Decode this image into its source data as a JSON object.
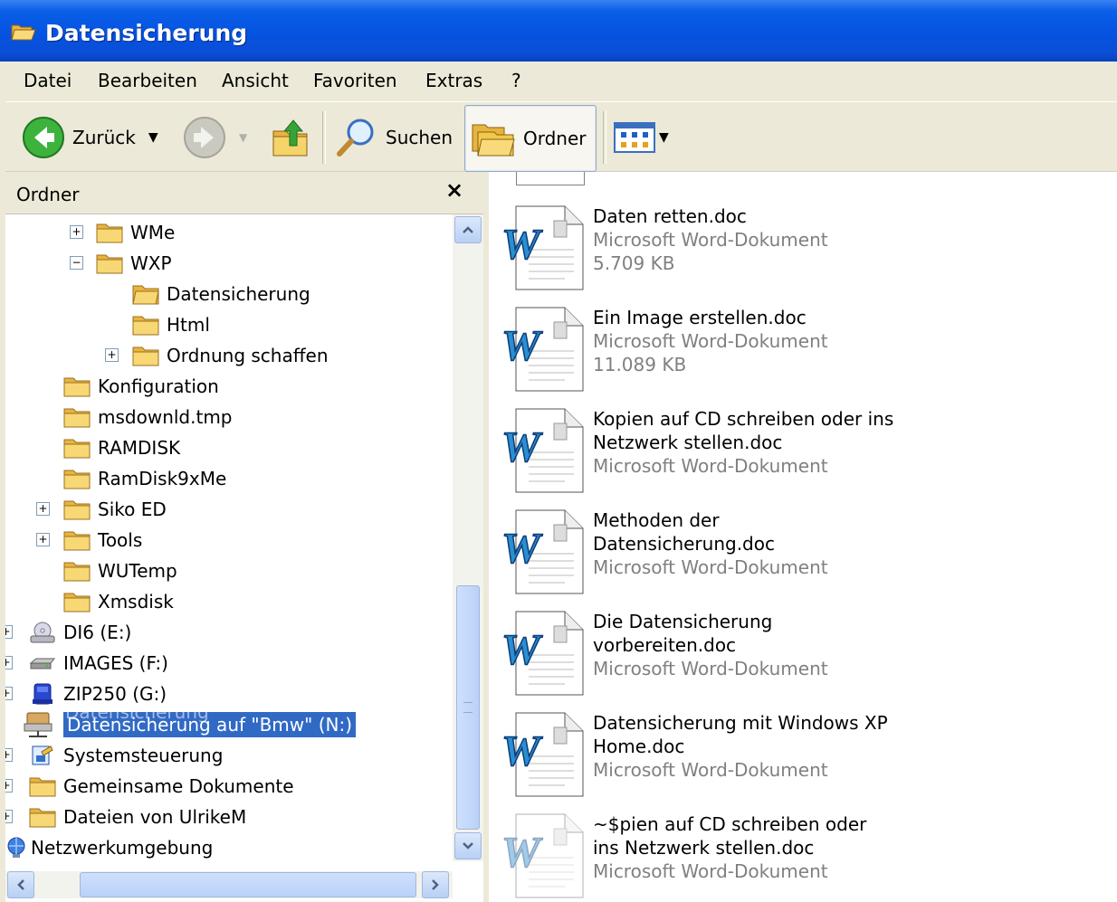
{
  "window": {
    "title": "Datensicherung"
  },
  "menu": [
    "Datei",
    "Bearbeiten",
    "Ansicht",
    "Favoriten",
    "Extras",
    "?"
  ],
  "toolbar": {
    "back": "Zurück",
    "search": "Suchen",
    "folders": "Ordner"
  },
  "folder_pane": {
    "title": "Ordner",
    "close": "×",
    "tree": [
      {
        "label": "WMe",
        "expander": "+"
      },
      {
        "label": "WXP",
        "expander": "−"
      },
      {
        "label": "Datensicherung"
      },
      {
        "label": "Html"
      },
      {
        "label": "Ordnung schaffen",
        "expander": "+"
      },
      {
        "label": "Konfiguration"
      },
      {
        "label": "msdownld.tmp"
      },
      {
        "label": "RAMDISK"
      },
      {
        "label": "RamDisk9xMe"
      },
      {
        "label": "Siko ED",
        "expander": "+"
      },
      {
        "label": "Tools",
        "expander": "+"
      },
      {
        "label": "WUTemp"
      },
      {
        "label": "Xmsdisk"
      },
      {
        "label": "DI6 (E:)",
        "expander": "+"
      },
      {
        "label": "IMAGES (F:)",
        "expander": "+"
      },
      {
        "label": "ZIP250 (G:)",
        "expander": "+"
      },
      {
        "label": "Datensicherung auf \"Bmw\" (N:)",
        "drag_ghost": "Datensicherung"
      },
      {
        "label": "Systemsteuerung",
        "expander": "+"
      },
      {
        "label": "Gemeinsame Dokumente",
        "expander": "+"
      },
      {
        "label": "Dateien von UlrikeM",
        "expander": "+"
      },
      {
        "label": "Netzwerkumgebung"
      }
    ]
  },
  "files": [
    {
      "name": "Daten retten.doc",
      "type": "Microsoft Word-Dokument",
      "size": "5.709 KB"
    },
    {
      "name": "Ein Image erstellen.doc",
      "type": "Microsoft Word-Dokument",
      "size": "11.089 KB"
    },
    {
      "name": "Kopien auf CD schreiben oder ins",
      "name2": "Netzwerk stellen.doc",
      "type": "Microsoft Word-Dokument"
    },
    {
      "name": "Methoden der",
      "name2": "Datensicherung.doc",
      "type": "Microsoft Word-Dokument"
    },
    {
      "name": "Die Datensicherung",
      "name2": "vorbereiten.doc",
      "type": "Microsoft Word-Dokument"
    },
    {
      "name": "Datensicherung mit Windows XP",
      "name2": "Home.doc",
      "type": "Microsoft Word-Dokument"
    },
    {
      "name": "~$pien auf CD schreiben oder",
      "name2": "ins Netzwerk stellen.doc",
      "type": "Microsoft Word-Dokument"
    }
  ],
  "icons": {
    "title": "folder-open-icon",
    "back": "back-arrow-icon",
    "forward": "forward-arrow-icon",
    "up": "folder-up-icon",
    "search": "magnifier-icon",
    "folders": "folders-icon",
    "views": "views-icon",
    "file": "word-document-icon"
  },
  "colors": {
    "titlebar": "#0553E1",
    "selection": "#316AC5",
    "face": "#ECE9D8",
    "folder": "#F2C94C"
  }
}
